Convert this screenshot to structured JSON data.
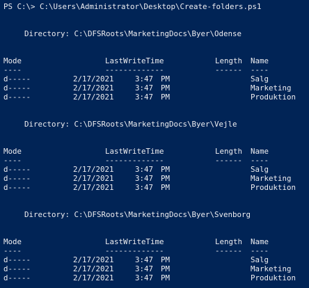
{
  "prompt": {
    "text": "PS C:\\> C:\\Users\\Administrator\\Desktop\\Create-folders.ps1"
  },
  "table_headers": {
    "mode": "Mode",
    "last_write_time": "LastWriteTime",
    "length": "Length",
    "name": "Name",
    "sep_mode": "----",
    "sep_lwt": "-------------",
    "sep_length": "------",
    "sep_name": "----"
  },
  "sections": [
    {
      "directory_label": "Directory: C:\\DFSRoots\\MarketingDocs\\Byer\\Odense",
      "rows": [
        {
          "mode": "d-----",
          "date": "2/17/2021",
          "time": "3:47",
          "ampm": "PM",
          "name": "Salg"
        },
        {
          "mode": "d-----",
          "date": "2/17/2021",
          "time": "3:47",
          "ampm": "PM",
          "name": "Marketing"
        },
        {
          "mode": "d-----",
          "date": "2/17/2021",
          "time": "3:47",
          "ampm": "PM",
          "name": "Produktion"
        }
      ]
    },
    {
      "directory_label": "Directory: C:\\DFSRoots\\MarketingDocs\\Byer\\Vejle",
      "rows": [
        {
          "mode": "d-----",
          "date": "2/17/2021",
          "time": "3:47",
          "ampm": "PM",
          "name": "Salg"
        },
        {
          "mode": "d-----",
          "date": "2/17/2021",
          "time": "3:47",
          "ampm": "PM",
          "name": "Marketing"
        },
        {
          "mode": "d-----",
          "date": "2/17/2021",
          "time": "3:47",
          "ampm": "PM",
          "name": "Produktion"
        }
      ]
    },
    {
      "directory_label": "Directory: C:\\DFSRoots\\MarketingDocs\\Byer\\Svenborg",
      "rows": [
        {
          "mode": "d-----",
          "date": "2/17/2021",
          "time": "3:47",
          "ampm": "PM",
          "name": "Salg"
        },
        {
          "mode": "d-----",
          "date": "2/17/2021",
          "time": "3:47",
          "ampm": "PM",
          "name": "Marketing"
        },
        {
          "mode": "d-----",
          "date": "2/17/2021",
          "time": "3:47",
          "ampm": "PM",
          "name": "Produktion"
        }
      ]
    }
  ],
  "colors": {
    "background": "#012456",
    "foreground": "#eeedf0"
  }
}
